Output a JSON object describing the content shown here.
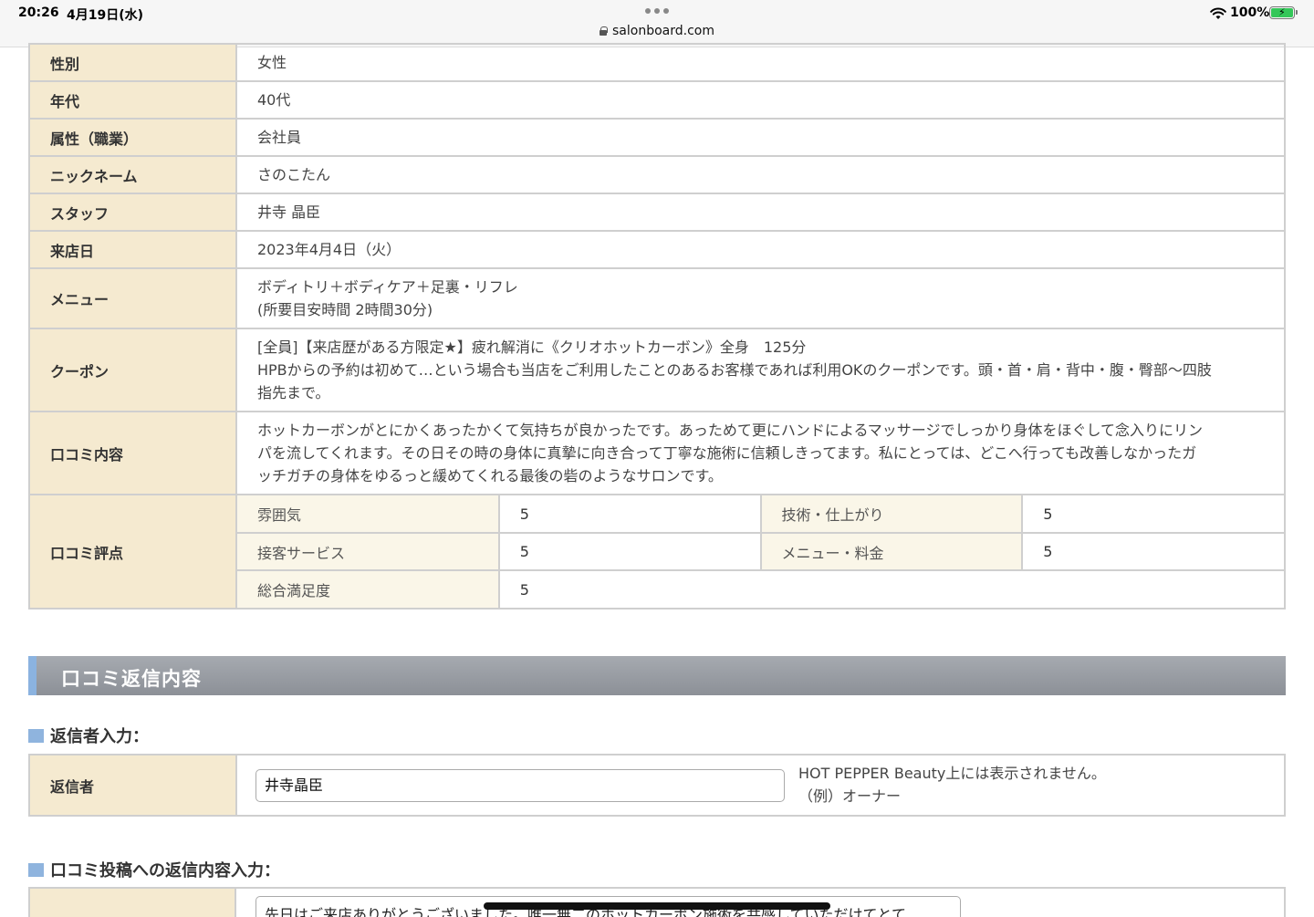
{
  "status": {
    "time": "20:26",
    "date": "4月19日(水)",
    "url": "salonboard.com",
    "battery": "100%"
  },
  "review": {
    "rows": [
      {
        "label": "性別",
        "value": "女性"
      },
      {
        "label": "年代",
        "value": "40代"
      },
      {
        "label": "属性（職業）",
        "value": "会社員"
      },
      {
        "label": "ニックネーム",
        "value": "さのこたん"
      },
      {
        "label": "スタッフ",
        "value": "井寺 晶臣"
      },
      {
        "label": "来店日",
        "value": "2023年4月4日（火）"
      }
    ],
    "menu": {
      "label": "メニュー",
      "line1": "ボディトリ＋ボディケア＋足裏・リフレ",
      "line2": "(所要目安時間 2時間30分)"
    },
    "coupon": {
      "label": "クーポン",
      "line1": "[全員]【来店歴がある方限定★】疲れ解消に《クリオホットカーボン》全身　125分",
      "line2": "HPBからの予約は初めて…という場合も当店をご利用したことのあるお客様であれば利用OKのクーポンです。頭・首・肩・背中・腹・臀部〜四肢",
      "line3": "指先まで。"
    },
    "comment": {
      "label": "口コミ内容",
      "line1": "ホットカーボンがとにかくあったかくて気持ちが良かったです。あっためて更にハンドによるマッサージでしっかり身体をほぐして念入りにリン",
      "line2": "パを流してくれます。その日その時の身体に真摯に向き合って丁寧な施術に信頼しきってます。私にとっては、どこへ行っても改善しなかったガ",
      "line3": "ッチガチの身体をゆるっと緩めてくれる最後の砦のようなサロンです。"
    },
    "scores": {
      "label": "口コミ評点",
      "atmosphere_label": "雰囲気",
      "atmosphere": "5",
      "technique_label": "技術・仕上がり",
      "technique": "5",
      "service_label": "接客サービス",
      "service": "5",
      "price_label": "メニュー・料金",
      "price": "5",
      "overall_label": "総合満足度",
      "overall": "5"
    }
  },
  "reply_section": {
    "title": "口コミ返信内容",
    "replier_heading": "返信者入力：",
    "replier_label": "返信者",
    "replier_value": "井寺晶臣",
    "note_line1": "HOT PEPPER Beauty上には表示されません。",
    "note_line2": "（例）オーナー",
    "content_heading": "口コミ投稿への返信内容入力：",
    "content_value": "先日はご来店ありがとうございました。唯一無二のホットカーボン施術を共感していただけてとて"
  }
}
